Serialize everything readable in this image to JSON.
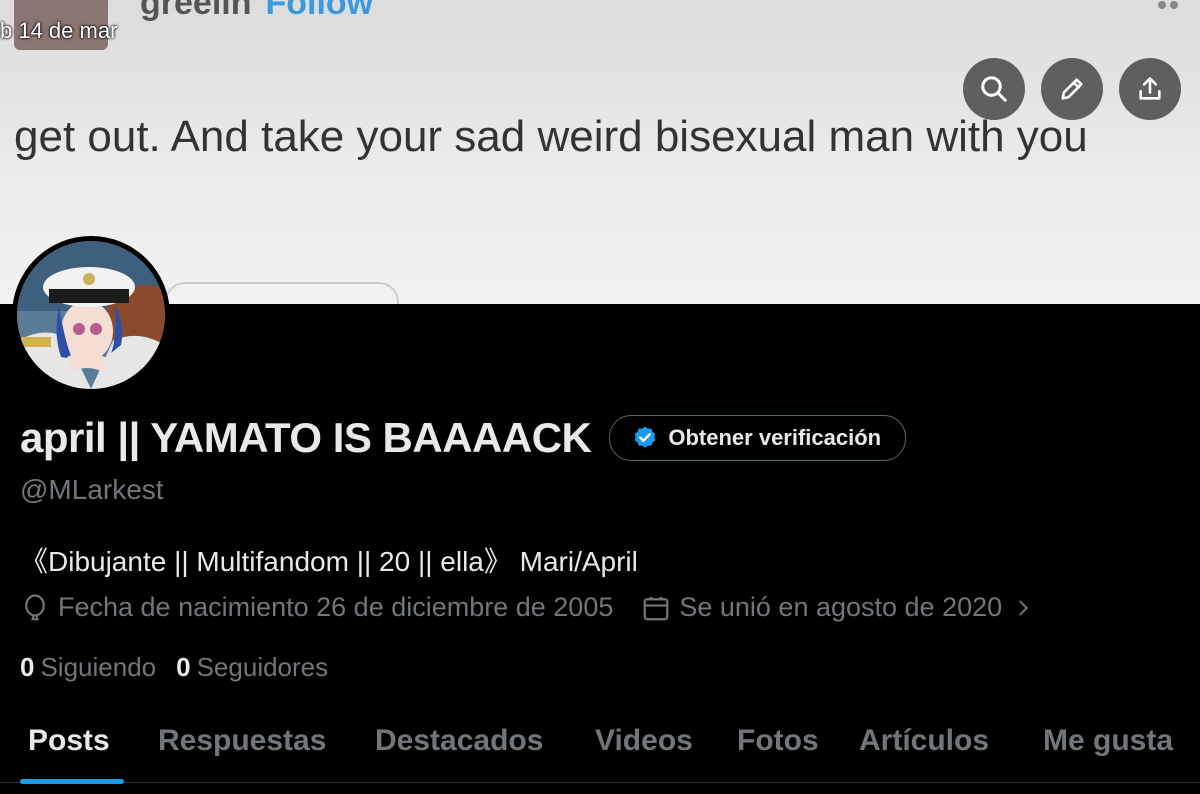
{
  "banner": {
    "username": "greelin",
    "follow_label": "Follow",
    "date": "b 14 de mar",
    "tweet_text": "get out.   And take your sad weird bisexual man with you"
  },
  "header_actions": [
    "search-icon",
    "edit-icon",
    "share-icon"
  ],
  "profile": {
    "name": "april || YAMATO IS BAAAACK",
    "verification_label": "Obtener verificación",
    "handle": "@MLarkest",
    "bio": "《Dibujante || Multifandom || 20 || ella》 Mari/April",
    "birthday": "Fecha de nacimiento 26 de diciembre de 2005",
    "joined": "Se unió en agosto de 2020",
    "following_count": "0",
    "following_label": "Siguiendo",
    "followers_count": "0",
    "followers_label": "Seguidores"
  },
  "tabs": [
    "Posts",
    "Respuestas",
    "Destacados",
    "Videos",
    "Fotos",
    "Artículos",
    "Me gusta"
  ],
  "colors": {
    "accent": "#1d9bf0",
    "text": "#e7e9ea",
    "muted": "#71767b",
    "bg": "#000000"
  }
}
